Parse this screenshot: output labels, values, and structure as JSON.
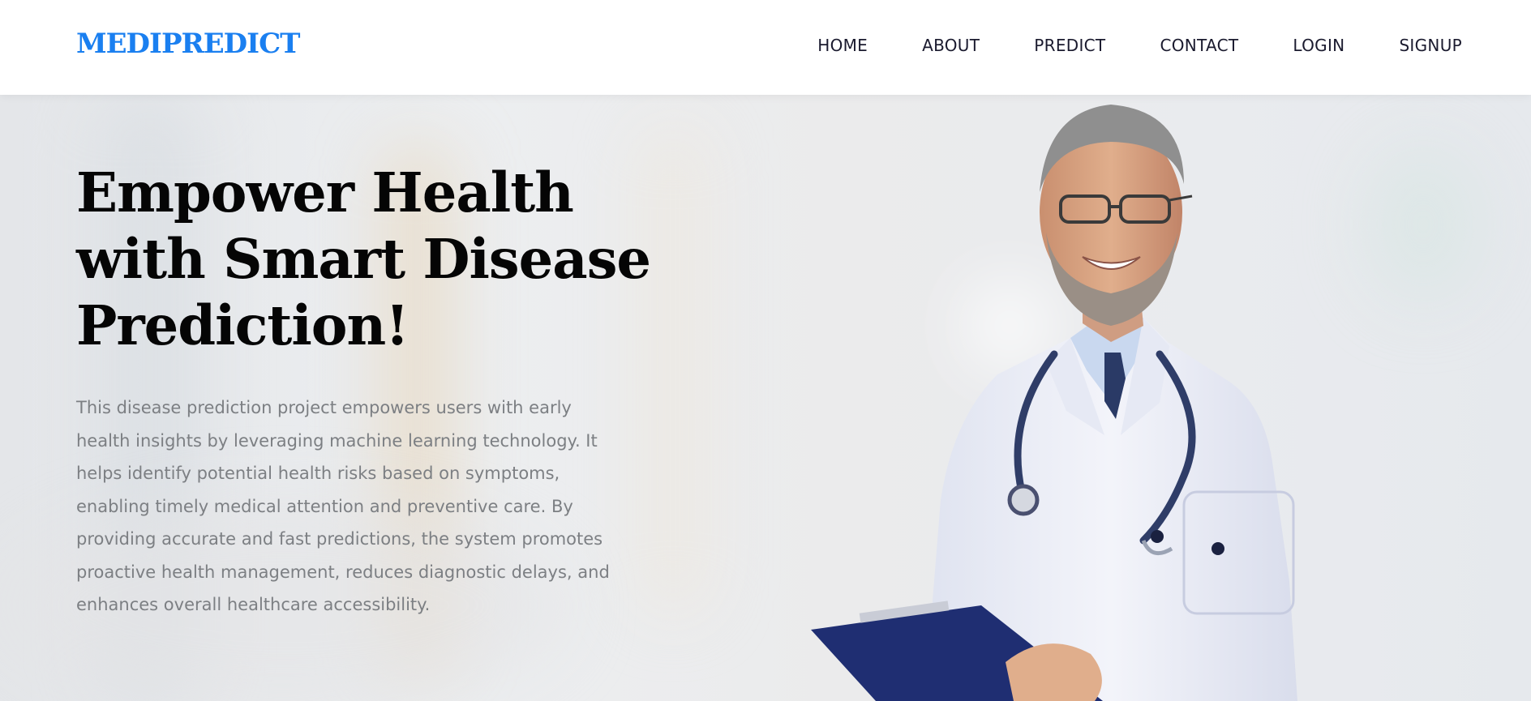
{
  "brand": {
    "name": "MEDIPREDICT"
  },
  "nav": {
    "items": [
      "HOME",
      "ABOUT",
      "PREDICT",
      "CONTACT",
      "LOGIN",
      "SIGNUP"
    ]
  },
  "hero": {
    "title": "Empower Health with Smart Disease Prediction!",
    "description": "This disease prediction project empowers users with early health insights by leveraging machine learning technology. It helps identify potential health risks based on symptoms, enabling timely medical attention and preventive care. By providing accurate and fast predictions, the system promotes proactive health management, reduces diagnostic delays, and enhances overall healthcare accessibility.",
    "image": "smiling-doctor-photo"
  },
  "colors": {
    "brand": "#1a7ff0",
    "nav_text": "#1a1a2e",
    "title": "#050505",
    "description": "#7c7f83",
    "coat": "#eef0f8",
    "tie": "#2a3a66",
    "clipboard": "#1f2e72"
  }
}
